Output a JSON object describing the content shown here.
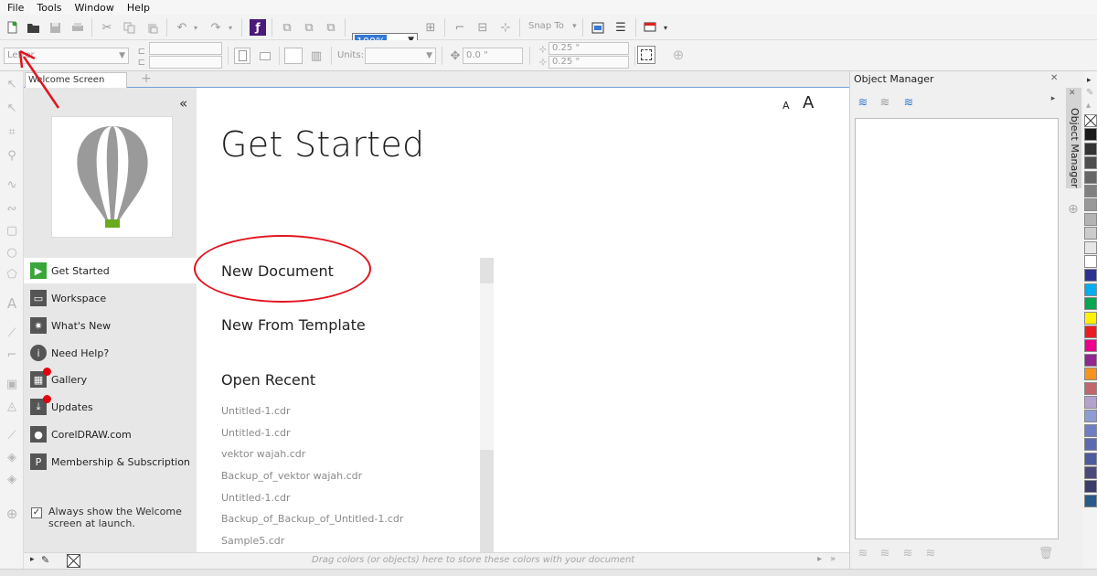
{
  "menu": [
    "File",
    "Tools",
    "Window",
    "Help"
  ],
  "toolbar": {
    "zoom": "100%",
    "snap_to": "Snap To",
    "snap_arrow": "▾",
    "page_size": "Letter",
    "units_label": "Units:",
    "position": "0.0 \"",
    "nudge_x": "0.25 \"",
    "nudge_y": "0.25 \""
  },
  "tabs": {
    "welcome": "Welcome Screen",
    "add": "+"
  },
  "welcome": {
    "collapse": "«",
    "nav": [
      {
        "label": "Get Started",
        "active": true
      },
      {
        "label": "Workspace"
      },
      {
        "label": "What's New"
      },
      {
        "label": "Need Help?"
      },
      {
        "label": "Gallery",
        "dot": true
      },
      {
        "label": "Updates",
        "dot": true
      },
      {
        "label": "CorelDRAW.com"
      },
      {
        "label": "Membership & Subscription"
      }
    ],
    "always_show": "Always show the Welcome screen at launch.",
    "font_small": "A",
    "font_large": "A",
    "title": "Get Started",
    "new_document": "New Document",
    "new_from_template": "New From Template",
    "open_recent": "Open Recent",
    "recent": [
      "Untitled-1.cdr",
      "Untitled-1.cdr",
      "vektor wajah.cdr",
      "Backup_of_vektor wajah.cdr",
      "Untitled-1.cdr",
      "Backup_of_Backup_of_Untitled-1.cdr",
      "Sample5.cdr"
    ]
  },
  "status": {
    "hint": "Drag colors (or objects) here to store these colors with your document"
  },
  "object_manager": {
    "title": "Object Manager",
    "vtab": "Object Manager"
  },
  "palette": [
    "#ffffff",
    "#1a1a1a",
    "#333333",
    "#4d4d4d",
    "#666666",
    "#808080",
    "#999999",
    "#b3b3b3",
    "#cccccc",
    "#e6e6e6",
    "#ffffff",
    "#2e3192",
    "#00aeef",
    "#00a651",
    "#fff200",
    "#ed1c24",
    "#ec008c",
    "#92278f",
    "#f7941d",
    "#c1666b",
    "#b5a1cf",
    "#8e9cd6",
    "#6f7ec2",
    "#5c6bb0",
    "#4e5a9e",
    "#4a4a7a",
    "#3c3c6a",
    "#2a5a8a"
  ],
  "colors": {
    "accent_red": "#e0151f",
    "nav_green": "#3aa53a",
    "nav_dark": "#555555",
    "selection_blue": "#3478d4"
  },
  "icons": {
    "new": "new-document-icon",
    "open": "open-folder-icon",
    "save": "save-icon",
    "print": "print-icon",
    "cut": "cut-icon",
    "copy": "copy-icon",
    "paste": "paste-icon",
    "undo": "undo-icon",
    "redo": "redo-icon"
  }
}
